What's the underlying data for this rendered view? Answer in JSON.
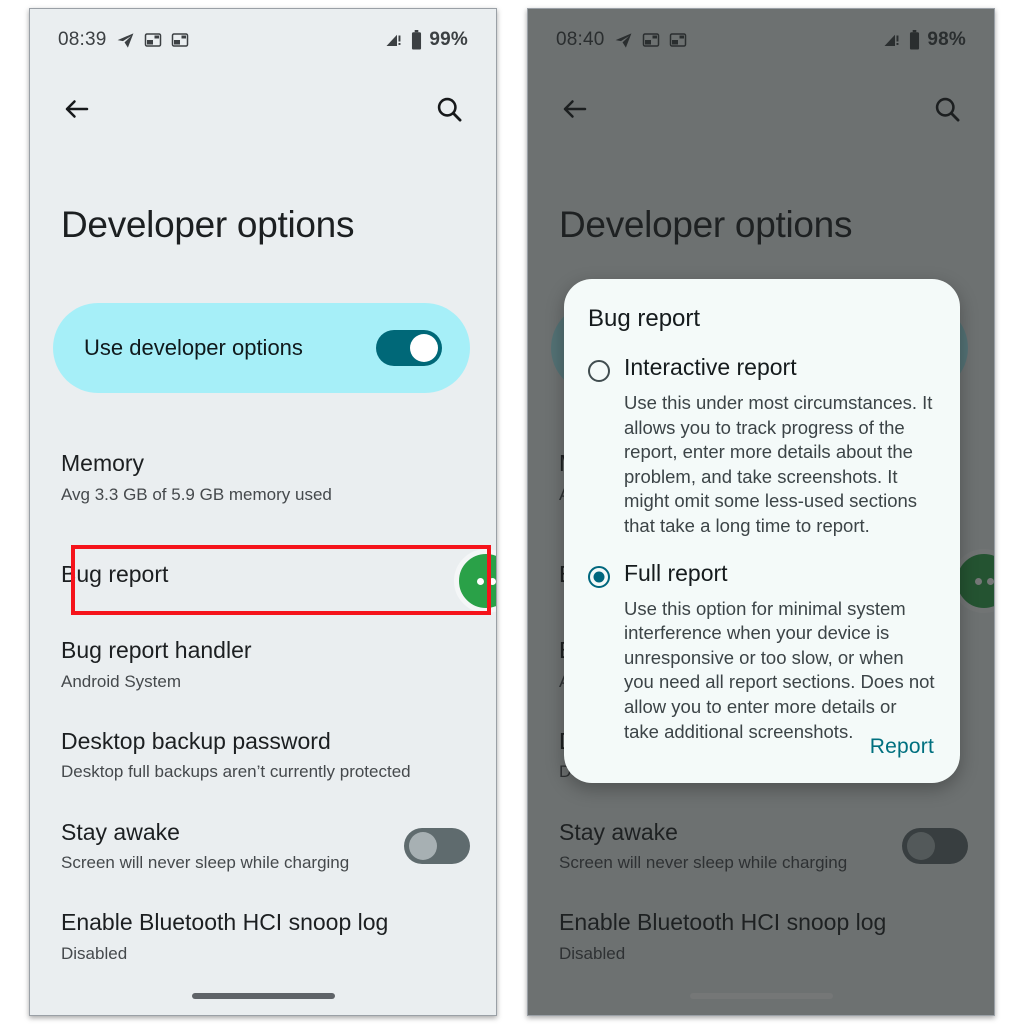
{
  "left_phone": {
    "status_bar": {
      "time": "08:39",
      "battery_percent": "99%",
      "icons": [
        "telegram-send-icon",
        "app-card-icon",
        "app-card-icon",
        "signal-warning-icon",
        "battery-icon"
      ]
    },
    "app_bar": {
      "back": "back-arrow-icon",
      "search": "search-icon"
    },
    "page_title": "Developer options",
    "master_toggle": {
      "label": "Use developer options",
      "state": "on"
    },
    "items": [
      {
        "title": "Memory",
        "subtitle": "Avg 3.3 GB of 5.9 GB memory used",
        "switch": null
      },
      {
        "title": "Bug report",
        "subtitle": "",
        "switch": null
      },
      {
        "title": "Bug report handler",
        "subtitle": "Android System",
        "switch": null
      },
      {
        "title": "Desktop backup password",
        "subtitle": "Desktop full backups aren’t currently protected",
        "switch": null
      },
      {
        "title": "Stay awake",
        "subtitle": "Screen will never sleep while charging",
        "switch": "off"
      },
      {
        "title": "Enable Bluetooth HCI snoop log",
        "subtitle": "Disabled",
        "switch": null
      }
    ],
    "annotation": {
      "target": "Bug report",
      "color": "#f5131b"
    },
    "floating_badge": {
      "name": "green-overflow-badge",
      "color": "#2aa148"
    }
  },
  "right_phone": {
    "status_bar": {
      "time": "08:40",
      "battery_percent": "98%",
      "icons": [
        "telegram-send-icon",
        "app-card-icon",
        "app-card-icon",
        "signal-warning-icon",
        "battery-icon"
      ]
    },
    "app_bar": {
      "back": "back-arrow-icon",
      "search": "search-icon"
    },
    "page_title": "Developer options",
    "items": [
      {
        "title": "Stay awake",
        "subtitle": "Screen will never sleep while charging",
        "switch": "off"
      },
      {
        "title": "Enable Bluetooth HCI snoop log",
        "subtitle": "Disabled",
        "switch": null
      }
    ],
    "dialog": {
      "title": "Bug report",
      "options": [
        {
          "label": "Interactive report",
          "selected": false,
          "description": "Use this under most circumstances. It allows you to track progress of the report, enter more details about the problem, and take screenshots. It might omit some less-used sections that take a long time to report."
        },
        {
          "label": "Full report",
          "selected": true,
          "description": "Use this option for minimal system interference when your device is unresponsive or too slow, or when you need all report sections. Does not allow you to enter more details or take additional screenshots."
        }
      ],
      "confirm_label": "Report",
      "accent_color": "#00707f"
    }
  }
}
